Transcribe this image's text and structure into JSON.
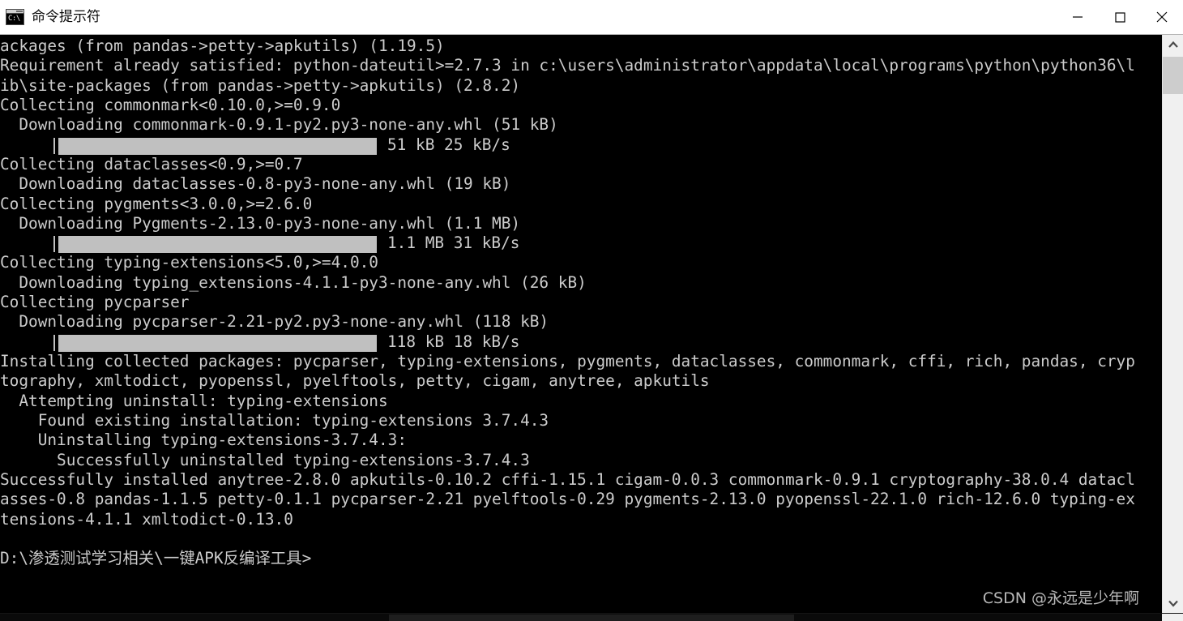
{
  "window": {
    "title": "命令提示符",
    "icon": "cmd-icon",
    "icon_text": "C:\\",
    "controls": {
      "minimize": "minimize-button",
      "maximize": "maximize-button",
      "close": "close-button"
    },
    "colors": {
      "titlebar_bg": "#ffffff",
      "title_fg": "#0a0a0a",
      "console_bg": "#000000",
      "console_fg": "#cccccc",
      "progress_fill": "#c0c0c0",
      "scrollbar_track": "#f0f0f0",
      "scrollbar_thumb": "#cdcdcd",
      "watermark_fg": "#b9b9b9"
    }
  },
  "console": {
    "lines": [
      {
        "type": "text",
        "text": "ackages (from pandas->petty->apkutils) (1.19.5)"
      },
      {
        "type": "text",
        "text": "Requirement already satisfied: python-dateutil>=2.7.3 in c:\\users\\administrator\\appdata\\local\\programs\\python\\python36\\l"
      },
      {
        "type": "text",
        "text": "ib\\site-packages (from pandas->petty->apkutils) (2.8.2)"
      },
      {
        "type": "text",
        "text": "Collecting commonmark<0.10.0,>=0.9.0"
      },
      {
        "type": "text",
        "text": "  Downloading commonmark-0.9.1-py2.py3-none-any.whl (51 kB)"
      },
      {
        "type": "progress",
        "fill_start": 72,
        "fill_width": 393,
        "text": "51 kB 25 kB/s",
        "text_left": 478
      },
      {
        "type": "text",
        "text": "Collecting dataclasses<0.9,>=0.7"
      },
      {
        "type": "text",
        "text": "  Downloading dataclasses-0.8-py3-none-any.whl (19 kB)"
      },
      {
        "type": "text",
        "text": "Collecting pygments<3.0.0,>=2.6.0"
      },
      {
        "type": "text",
        "text": "  Downloading Pygments-2.13.0-py3-none-any.whl (1.1 MB)"
      },
      {
        "type": "progress",
        "fill_start": 72,
        "fill_width": 393,
        "text": "1.1 MB 31 kB/s",
        "text_left": 478
      },
      {
        "type": "text",
        "text": "Collecting typing-extensions<5.0,>=4.0.0"
      },
      {
        "type": "text",
        "text": "  Downloading typing_extensions-4.1.1-py3-none-any.whl (26 kB)"
      },
      {
        "type": "text",
        "text": "Collecting pycparser"
      },
      {
        "type": "text",
        "text": "  Downloading pycparser-2.21-py2.py3-none-any.whl (118 kB)"
      },
      {
        "type": "progress",
        "fill_start": 72,
        "fill_width": 393,
        "text": "118 kB 18 kB/s",
        "text_left": 478
      },
      {
        "type": "text",
        "text": "Installing collected packages: pycparser, typing-extensions, pygments, dataclasses, commonmark, cffi, rich, pandas, cryp"
      },
      {
        "type": "text",
        "text": "tography, xmltodict, pyopenssl, pyelftools, petty, cigam, anytree, apkutils"
      },
      {
        "type": "text",
        "text": "  Attempting uninstall: typing-extensions"
      },
      {
        "type": "text",
        "text": "    Found existing installation: typing-extensions 3.7.4.3"
      },
      {
        "type": "text",
        "text": "    Uninstalling typing-extensions-3.7.4.3:"
      },
      {
        "type": "text",
        "text": "      Successfully uninstalled typing-extensions-3.7.4.3"
      },
      {
        "type": "text",
        "text": "Successfully installed anytree-2.8.0 apkutils-0.10.2 cffi-1.15.1 cigam-0.0.3 commonmark-0.9.1 cryptography-38.0.4 datacl"
      },
      {
        "type": "text",
        "text": "asses-0.8 pandas-1.1.5 petty-0.1.1 pycparser-2.21 pyelftools-0.29 pygments-2.13.0 pyopenssl-22.1.0 rich-12.6.0 typing-ex"
      },
      {
        "type": "text",
        "text": "tensions-4.1.1 xmltodict-0.13.0"
      },
      {
        "type": "text",
        "text": ""
      },
      {
        "type": "text",
        "text": "D:\\渗透测试学习相关\\一键APK反编译工具>"
      }
    ],
    "watermark": "CSDN @永远是少年啊"
  },
  "scrollbars": {
    "vertical": {
      "up_arrow": "chevron-up-icon",
      "down_arrow": "chevron-down-icon",
      "thumb": "vertical-scroll-thumb"
    },
    "horizontal": {
      "thumb": "horizontal-scroll-thumb"
    }
  }
}
